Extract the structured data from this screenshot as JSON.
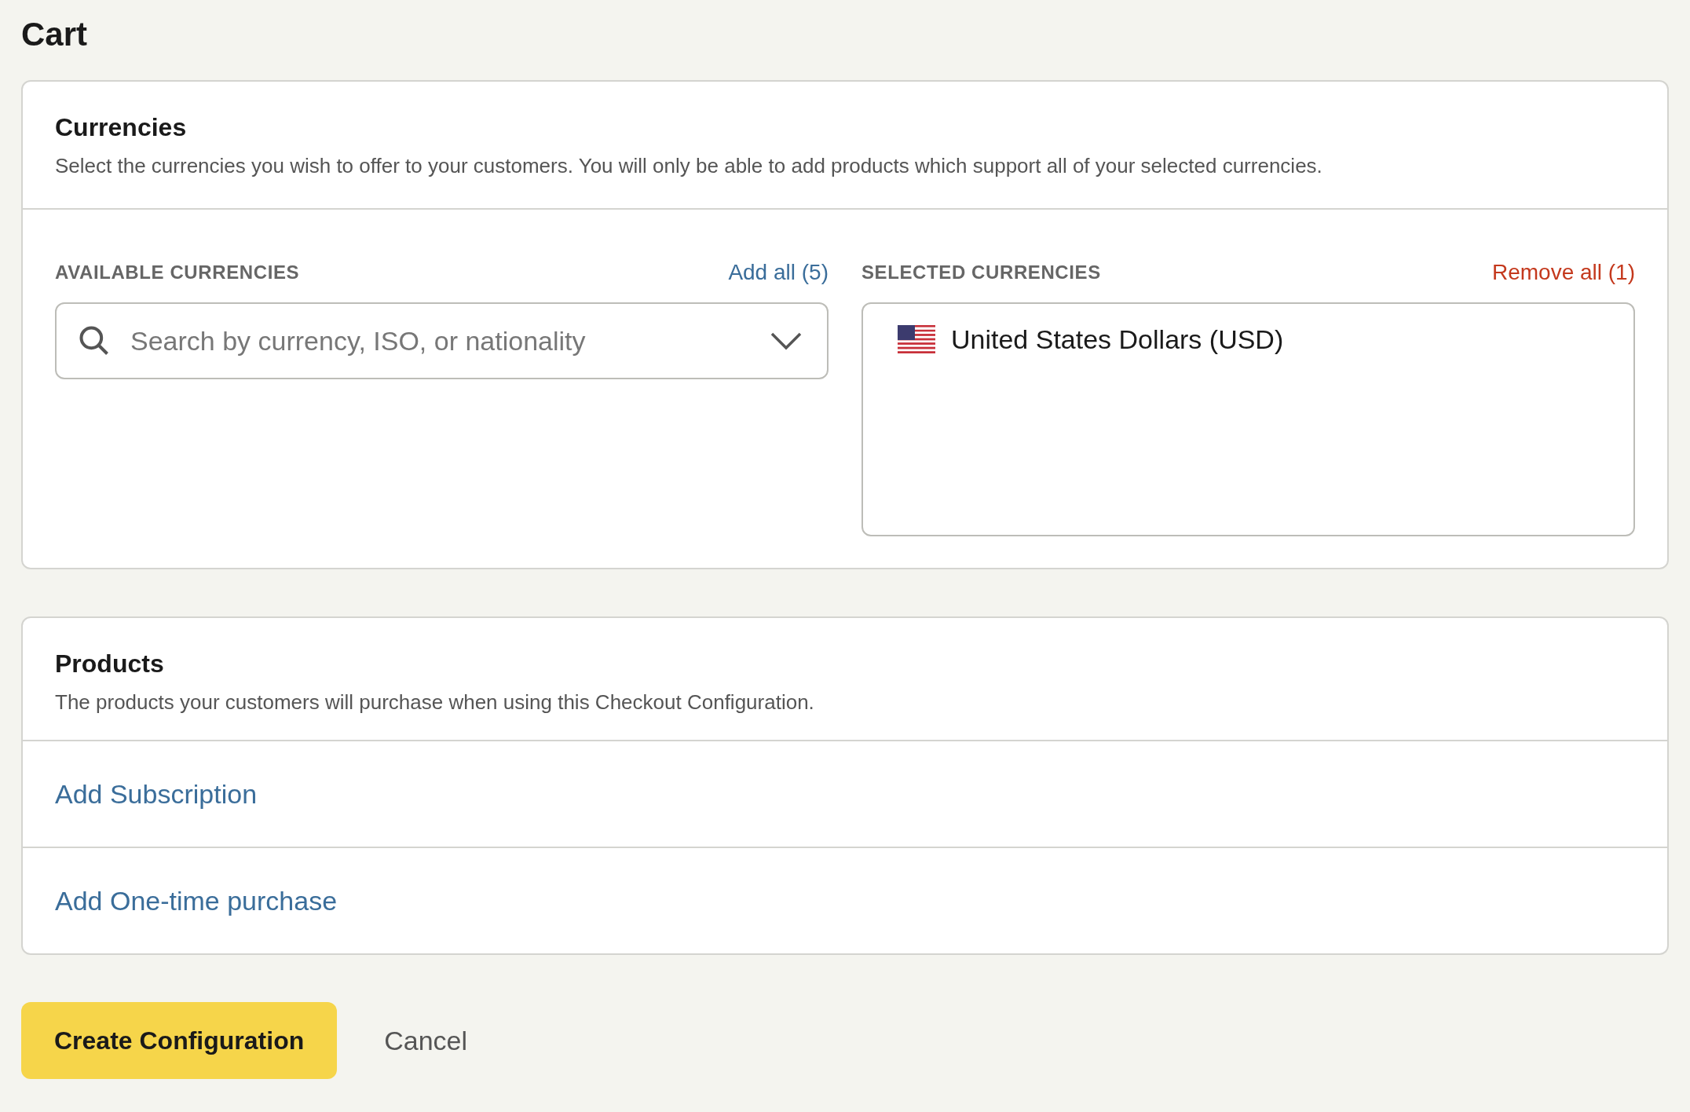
{
  "page_title": "Cart",
  "currencies": {
    "title": "Currencies",
    "description": "Select the currencies you wish to offer to your customers. You will only be able to add products which support all of your selected currencies.",
    "available": {
      "label": "AVAILABLE CURRENCIES",
      "add_all": "Add all (5)",
      "search": {
        "placeholder": "Search by currency, ISO, or nationality"
      }
    },
    "selected": {
      "label": "SELECTED CURRENCIES",
      "remove_all": "Remove all (1)",
      "items": [
        {
          "name": "United States Dollars (USD)"
        }
      ]
    }
  },
  "products": {
    "title": "Products",
    "description": "The products your customers will purchase when using this Checkout Configuration.",
    "actions": [
      "Add Subscription",
      "Add One-time purchase"
    ]
  },
  "buttons": [
    {
      "label": "Create Configuration",
      "kind": "primary"
    },
    {
      "label": "Cancel",
      "kind": "plain"
    }
  ]
}
